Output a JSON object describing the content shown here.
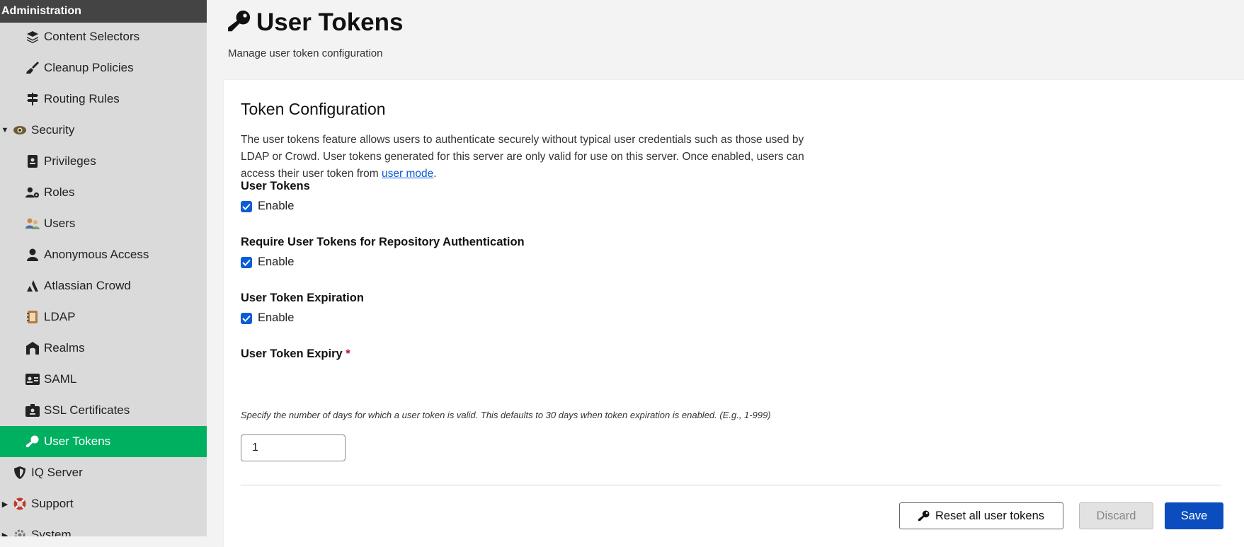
{
  "sidebar": {
    "header": "Administration",
    "items": [
      {
        "label": "Content Selectors",
        "icon": "layers-icon"
      },
      {
        "label": "Cleanup Policies",
        "icon": "broom-icon"
      },
      {
        "label": "Routing Rules",
        "icon": "signpost-icon"
      },
      {
        "label": "Security",
        "icon": "eye-icon"
      },
      {
        "label": "Privileges",
        "icon": "badge-icon"
      },
      {
        "label": "Roles",
        "icon": "user-gear-icon"
      },
      {
        "label": "Users",
        "icon": "users-icon"
      },
      {
        "label": "Anonymous Access",
        "icon": "user-icon"
      },
      {
        "label": "Atlassian Crowd",
        "icon": "atlassian-icon"
      },
      {
        "label": "LDAP",
        "icon": "address-book-icon"
      },
      {
        "label": "Realms",
        "icon": "archway-icon"
      },
      {
        "label": "SAML",
        "icon": "id-card-icon"
      },
      {
        "label": "SSL Certificates",
        "icon": "id-badge-icon"
      },
      {
        "label": "User Tokens",
        "icon": "key-icon"
      },
      {
        "label": "IQ Server",
        "icon": "shield-icon"
      },
      {
        "label": "Support",
        "icon": "lifebuoy-icon"
      },
      {
        "label": "System",
        "icon": "gear-icon"
      }
    ],
    "active_color": "#00b061"
  },
  "page": {
    "title": "User Tokens",
    "subtitle": "Manage user token configuration"
  },
  "card": {
    "title": "Token Configuration",
    "desc_before": "The user tokens feature allows users to authenticate securely without typical user credentials such as those used by LDAP or Crowd. User tokens generated for this server are only valid for use on this server. Once enabled, users can access their user token from ",
    "desc_link": "user mode",
    "desc_after": ".",
    "user_tokens": {
      "label": "User Tokens",
      "option": "Enable",
      "checked": true
    },
    "require_tokens": {
      "label": "Require User Tokens for Repository Authentication",
      "option": "Enable",
      "checked": true
    },
    "expiration": {
      "label": "User Token Expiration",
      "option": "Enable",
      "checked": true
    },
    "expiry": {
      "label": "User Token Expiry",
      "required_mark": "*",
      "help": "Specify the number of days for which a user token is valid. This defaults to 30 days when token expiration is enabled. (E.g., 1-999)",
      "value": "1"
    }
  },
  "buttons": {
    "reset": "Reset all user tokens",
    "discard": "Discard",
    "save": "Save"
  }
}
